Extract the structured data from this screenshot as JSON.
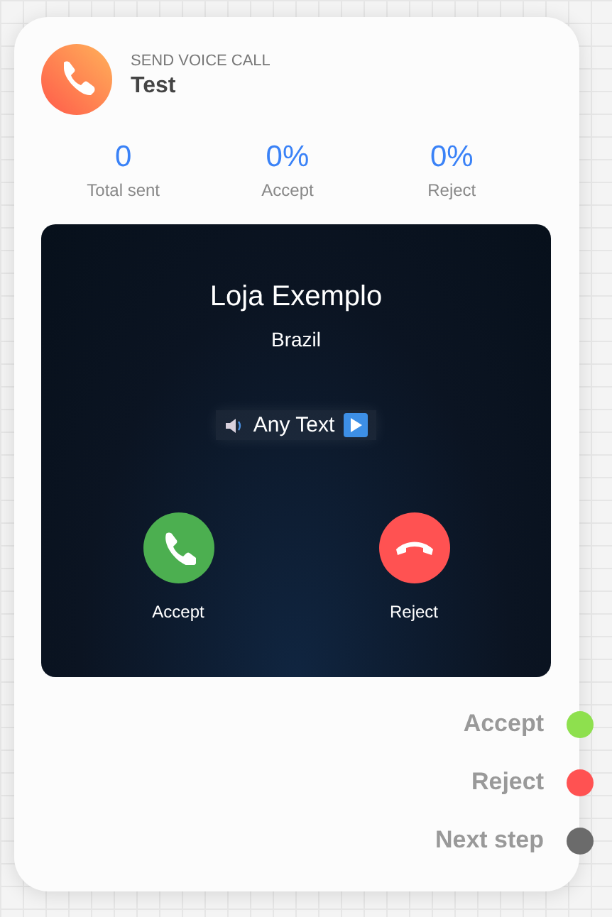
{
  "node": {
    "type_label": "SEND VOICE CALL",
    "title": "Test"
  },
  "stats": [
    {
      "value": "0",
      "label": "Total sent"
    },
    {
      "value": "0%",
      "label": "Accept"
    },
    {
      "value": "0%",
      "label": "Reject"
    }
  ],
  "call_screen": {
    "caller": "Loja Exemplo",
    "location": "Brazil",
    "message": "Any Text",
    "buttons": [
      {
        "kind": "accept",
        "label": "Accept"
      },
      {
        "kind": "reject",
        "label": "Reject"
      }
    ]
  },
  "outputs": [
    {
      "label": "Accept",
      "color": "#8ee04e"
    },
    {
      "label": "Reject",
      "color": "#ff5252"
    },
    {
      "label": "Next step",
      "color": "#6b6b6b"
    }
  ]
}
